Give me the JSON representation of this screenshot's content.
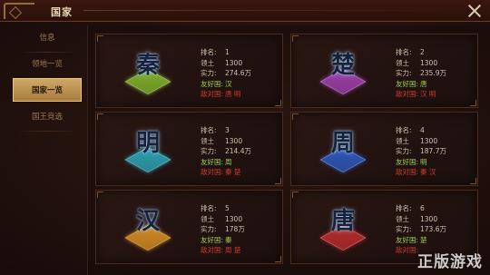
{
  "window": {
    "title": "国家"
  },
  "sidebar": {
    "items": [
      {
        "label": "信息",
        "active": false
      },
      {
        "label": "领地一览",
        "active": false
      },
      {
        "label": "国家一览",
        "active": true
      },
      {
        "label": "国王竞选",
        "active": false
      }
    ]
  },
  "labels": {
    "rank": "排名:",
    "territory": "领土",
    "power": "实力:",
    "friend": "友好国:",
    "enemy": "敌对国:"
  },
  "countries": [
    {
      "name": "秦",
      "rank": "1",
      "territory": "1300",
      "power": "274.6万",
      "friend": "汉",
      "enemy": "唐 明",
      "color": "#7fae2c"
    },
    {
      "name": "楚",
      "rank": "2",
      "territory": "1300",
      "power": "235.9万",
      "friend": "唐",
      "enemy": "汉 明",
      "color": "#9b3fa8"
    },
    {
      "name": "明",
      "rank": "3",
      "territory": "1300",
      "power": "214.4万",
      "friend": "周",
      "enemy": "秦 楚",
      "color": "#2aa0b0"
    },
    {
      "name": "周",
      "rank": "4",
      "territory": "1300",
      "power": "187.7万",
      "friend": "明",
      "enemy": "秦 汉",
      "color": "#2d56b8"
    },
    {
      "name": "汉",
      "rank": "5",
      "territory": "1300",
      "power": "178万",
      "friend": "秦",
      "enemy": "周 楚",
      "color": "#d08a22"
    },
    {
      "name": "唐",
      "rank": "6",
      "territory": "1300",
      "power": "173.6万",
      "friend": "楚",
      "enemy": "",
      "color": "#b52a2a"
    }
  ],
  "watermark": {
    "text": "正版游戏"
  }
}
